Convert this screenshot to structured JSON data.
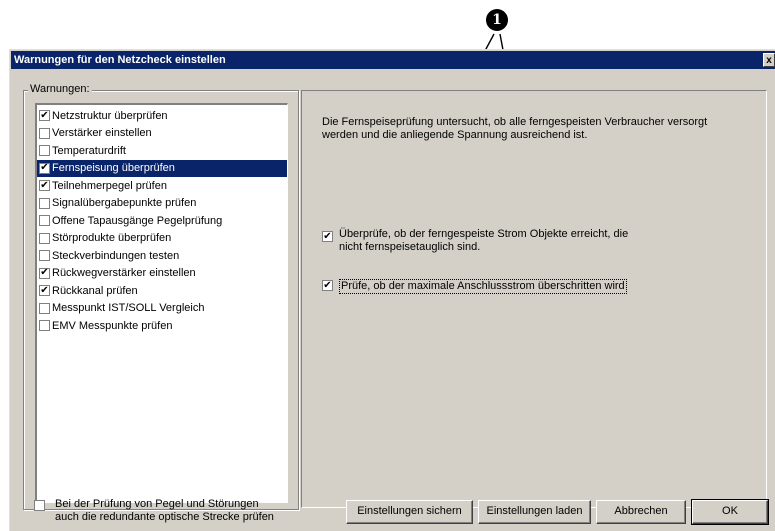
{
  "callout": {
    "number": "1"
  },
  "dialog": {
    "title": "Warnungen für den Netzcheck einstellen",
    "close_label": "x",
    "group_label": "Warnungen:",
    "warnings": [
      {
        "label": "Netzstruktur überprüfen",
        "checked": true,
        "selected": false
      },
      {
        "label": "Verstärker einstellen",
        "checked": false,
        "selected": false
      },
      {
        "label": "Temperaturdrift",
        "checked": false,
        "selected": false
      },
      {
        "label": "Fernspeisung überprüfen",
        "checked": true,
        "selected": true
      },
      {
        "label": "Teilnehmerpegel prüfen",
        "checked": true,
        "selected": false
      },
      {
        "label": "Signalübergabepunkte prüfen",
        "checked": false,
        "selected": false
      },
      {
        "label": "Offene Tapausgänge Pegelprüfung",
        "checked": false,
        "selected": false
      },
      {
        "label": "Störprodukte überprüfen",
        "checked": false,
        "selected": false
      },
      {
        "label": "Steckverbindungen testen",
        "checked": false,
        "selected": false
      },
      {
        "label": "Rückwegverstärker einstellen",
        "checked": true,
        "selected": false
      },
      {
        "label": "Rückkanal prüfen",
        "checked": true,
        "selected": false
      },
      {
        "label": "Messpunkt IST/SOLL Vergleich",
        "checked": false,
        "selected": false
      },
      {
        "label": "EMV Messpunkte prüfen",
        "checked": false,
        "selected": false
      }
    ],
    "description_line1": "Die Fernspeiseprüfung untersucht, ob alle ferngespeisten Verbraucher versorgt",
    "description_line2": "werden und die anliegende Spannung ausreichend ist.",
    "option1": {
      "line1": "Überprüfe, ob der ferngespeiste Strom Objekte erreicht, die",
      "line2": "nicht fernspeisetauglich sind.",
      "checked": true
    },
    "option2": {
      "label": "Prüfe, ob der maximale Anschlussstrom überschritten wird",
      "checked": true
    },
    "bottom_option": {
      "line1": "Bei der Prüfung von Pegel und Störungen",
      "line2": "auch die redundante optische Strecke prüfen",
      "checked": false
    },
    "buttons": {
      "save": "Einstellungen sichern",
      "load": "Einstellungen laden",
      "cancel": "Abbrechen",
      "ok": "OK"
    }
  }
}
